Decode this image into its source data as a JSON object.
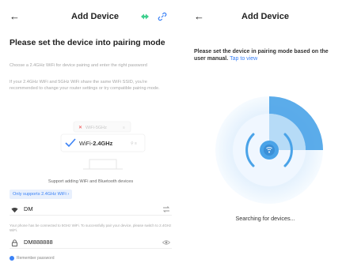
{
  "left": {
    "header": {
      "title": "Add Device",
      "back_icon": "arrow-left-icon"
    },
    "heading": "Please set the device into pairing mode",
    "sub1": "Choose a 2.4GHz WiFi for device pairing and enter the right password",
    "sub2": "If your 2.4GHz WiFi and 5GHz WiFi share the same WiFi SSID, you're recommended to change your router settings or try compatible pairing mode.",
    "router": {
      "wifi5": "WiFi-5GHz",
      "wifi24_prefix": "WiFi-",
      "wifi24_band": "2.4GHz"
    },
    "support_text": "Support adding WiFi and Bluetooth devices",
    "only_chip": "Only supports 2.4GHz WiFi ›",
    "wifi_field": {
      "value": "DM",
      "icon": "wifi-icon"
    },
    "warning": "Your phone has be connected to 5GHz WiFi. To successfully pair your device, please switch to 2.4GHz WiFi.",
    "password_field": {
      "value": "DM888888",
      "icon": "lock-icon"
    },
    "remember": "Remember password"
  },
  "right": {
    "header": {
      "title": "Add Device"
    },
    "instruction": "Please set the device in pairing mode based on the user manual.",
    "tap_link": "Tap to view",
    "searching": "Searching for devices..."
  },
  "colors": {
    "accent": "#3b82f6",
    "radar": "#4aa3e8",
    "green": "#3ecf8e"
  }
}
